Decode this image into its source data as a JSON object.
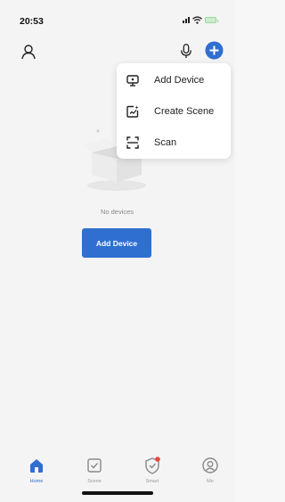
{
  "status_bar": {
    "time": "20:53",
    "icons": [
      "signal-icon",
      "wifi-icon",
      "battery-icon"
    ]
  },
  "top_bar": {
    "icons": [
      "profile-icon",
      "microphone-icon",
      "add-circle-icon"
    ]
  },
  "popup_menu": {
    "items": [
      {
        "label": "Add Device",
        "icon": "add-device-icon"
      },
      {
        "label": "Create Scene",
        "icon": "create-scene-icon"
      },
      {
        "label": "Scan",
        "icon": "scan-icon"
      }
    ]
  },
  "empty_state": {
    "icon": "empty-box-icon",
    "message": "No devices",
    "button_label": "Add Device"
  },
  "tab_bar": {
    "tabs": [
      {
        "label": "Home",
        "icon": "home-icon",
        "active": true
      },
      {
        "label": "Scene",
        "icon": "scene-icon",
        "active": false
      },
      {
        "label": "Smart",
        "icon": "smart-icon",
        "active": false,
        "badge": true
      },
      {
        "label": "Me",
        "icon": "me-icon",
        "active": false
      }
    ]
  },
  "colors": {
    "accent": "#2f6fd0",
    "background": "#f4f4f4",
    "badge": "#e8453c"
  }
}
